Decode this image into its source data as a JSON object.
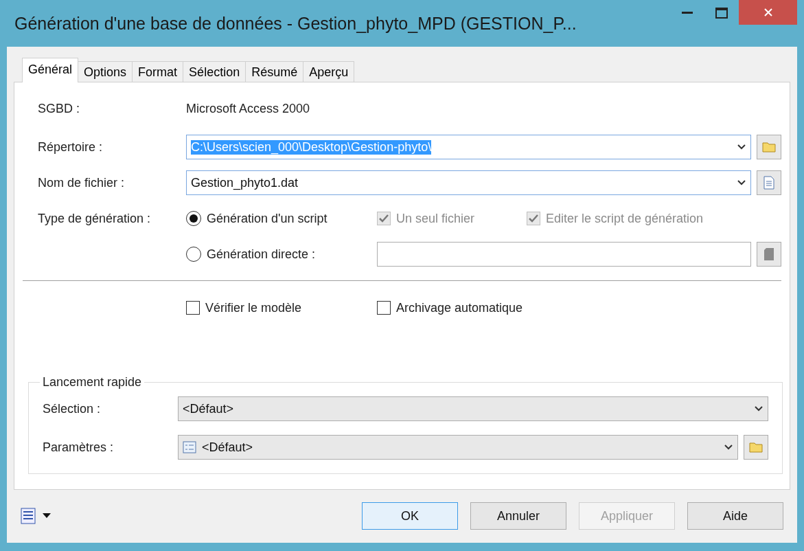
{
  "window": {
    "title": "Génération d'une base de données - Gestion_phyto_MPD (GESTION_P..."
  },
  "tabs": [
    {
      "label": "Général",
      "selected": true
    },
    {
      "label": "Options",
      "selected": false
    },
    {
      "label": "Format",
      "selected": false
    },
    {
      "label": "Sélection",
      "selected": false
    },
    {
      "label": "Résumé",
      "selected": false
    },
    {
      "label": "Aperçu",
      "selected": false
    }
  ],
  "dbms": {
    "label": "SGBD :",
    "value": "Microsoft Access 2000"
  },
  "directory": {
    "label": "Répertoire :",
    "value": "C:\\Users\\scien_000\\Desktop\\Gestion-phyto\\",
    "text_selected": true
  },
  "file_name": {
    "label": "Nom de fichier :",
    "value": "Gestion_phyto1.dat"
  },
  "generation_type": {
    "label": "Type de génération :",
    "options": [
      {
        "label": "Génération d'un script",
        "selected": true
      },
      {
        "label": "Génération directe :",
        "selected": false
      }
    ]
  },
  "script_options": [
    {
      "label": "Un seul fichier",
      "checked": true,
      "disabled": true
    },
    {
      "label": "Editer le script de génération",
      "checked": true,
      "disabled": true
    }
  ],
  "checks": [
    {
      "label": "Vérifier le modèle",
      "checked": false,
      "disabled": false
    },
    {
      "label": "Archivage automatique",
      "checked": false,
      "disabled": false
    }
  ],
  "quick_launch": {
    "title": "Lancement rapide",
    "rows": [
      {
        "label": "Sélection :",
        "value": "<Défaut>",
        "kind": "plain"
      },
      {
        "label": "Paramètres :",
        "value": "<Défaut>",
        "kind": "browse"
      }
    ]
  },
  "buttons": [
    {
      "label": "OK",
      "default": true,
      "disabled": false
    },
    {
      "label": "Annuler",
      "default": false,
      "disabled": false
    },
    {
      "label": "Appliquer",
      "default": false,
      "disabled": true
    },
    {
      "label": "Aide",
      "default": false,
      "disabled": false
    }
  ]
}
